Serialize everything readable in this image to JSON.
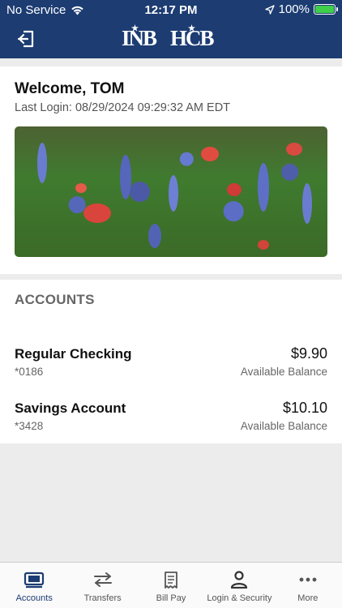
{
  "status_bar": {
    "carrier": "No Service",
    "time": "12:17 PM",
    "battery": "100%"
  },
  "header": {
    "logos": [
      "INB",
      "HCB"
    ]
  },
  "welcome": {
    "greeting": "Welcome, TOM",
    "last_login": "Last Login: 08/29/2024 09:29:32 AM EDT"
  },
  "accounts": {
    "title": "ACCOUNTS",
    "items": [
      {
        "name": "Regular Checking",
        "number": "*0186",
        "balance": "$9.90",
        "balance_label": "Available Balance"
      },
      {
        "name": "Savings Account",
        "number": "*3428",
        "balance": "$10.10",
        "balance_label": "Available Balance"
      }
    ]
  },
  "tabbar": {
    "items": [
      {
        "label": "Accounts",
        "icon": "accounts-icon",
        "active": true
      },
      {
        "label": "Transfers",
        "icon": "transfer-arrows-icon",
        "active": false
      },
      {
        "label": "Bill Pay",
        "icon": "receipt-icon",
        "active": false
      },
      {
        "label": "Login & Security",
        "icon": "person-icon",
        "active": false
      },
      {
        "label": "More",
        "icon": "more-dots-icon",
        "active": false
      }
    ]
  },
  "colors": {
    "brand": "#1c3c72",
    "battery": "#3fcf4a"
  }
}
